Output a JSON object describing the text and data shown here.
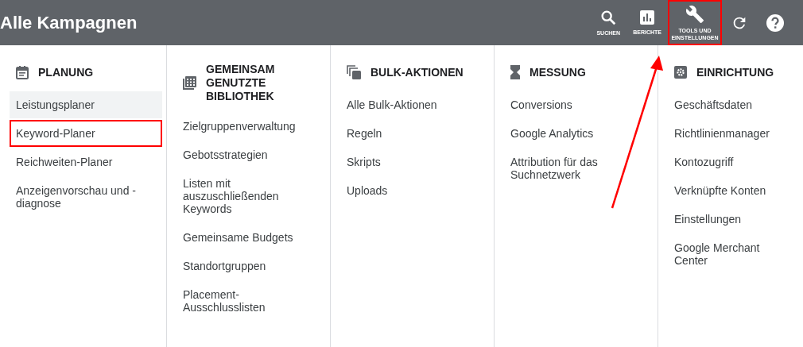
{
  "header": {
    "title": "Alle Kampagnen",
    "actions": [
      {
        "kind": "search",
        "label": "SUCHEN",
        "outlined": false
      },
      {
        "kind": "reports",
        "label": "BERICHTE",
        "outlined": false
      },
      {
        "kind": "tools",
        "label": "TOOLS UND EINSTELLUNGEN",
        "outlined": true
      },
      {
        "kind": "refresh",
        "outlined": false
      },
      {
        "kind": "help",
        "outlined": false
      }
    ]
  },
  "columns": [
    {
      "kind": "calendar",
      "title": "PLANUNG",
      "items": [
        {
          "label": "Leistungsplaner",
          "hovered": true,
          "outlined": false
        },
        {
          "label": "Keyword-Planer",
          "hovered": false,
          "outlined": true
        },
        {
          "label": "Reichweiten-Planer",
          "hovered": false,
          "outlined": false
        },
        {
          "label": "Anzeigenvorschau und -diagnose",
          "hovered": false,
          "outlined": false
        }
      ]
    },
    {
      "kind": "library",
      "title": "GEMEINSAM GENUTZTE BIBLIOTHEK",
      "items": [
        {
          "label": "Zielgruppenverwaltung",
          "hovered": false,
          "outlined": false
        },
        {
          "label": "Gebotsstrategien",
          "hovered": false,
          "outlined": false
        },
        {
          "label": "Listen mit auszuschließenden Keywords",
          "hovered": false,
          "outlined": false
        },
        {
          "label": "Gemeinsame Budgets",
          "hovered": false,
          "outlined": false
        },
        {
          "label": "Standortgruppen",
          "hovered": false,
          "outlined": false
        },
        {
          "label": "Placement-Ausschlusslisten",
          "hovered": false,
          "outlined": false
        }
      ]
    },
    {
      "kind": "copies",
      "title": "BULK-AKTIONEN",
      "items": [
        {
          "label": "Alle Bulk-Aktionen",
          "hovered": false,
          "outlined": false
        },
        {
          "label": "Regeln",
          "hovered": false,
          "outlined": false
        },
        {
          "label": "Skripts",
          "hovered": false,
          "outlined": false
        },
        {
          "label": "Uploads",
          "hovered": false,
          "outlined": false
        }
      ]
    },
    {
      "kind": "hourglass",
      "title": "MESSUNG",
      "items": [
        {
          "label": "Conversions",
          "hovered": false,
          "outlined": false
        },
        {
          "label": "Google Analytics",
          "hovered": false,
          "outlined": false
        },
        {
          "label": "Attribution für das Suchnetzwerk",
          "hovered": false,
          "outlined": false
        }
      ]
    },
    {
      "kind": "gear",
      "title": "EINRICHTUNG",
      "items": [
        {
          "label": "Geschäftsdaten",
          "hovered": false,
          "outlined": false
        },
        {
          "label": "Richtlinienmanager",
          "hovered": false,
          "outlined": false
        },
        {
          "label": "Kontozugriff",
          "hovered": false,
          "outlined": false
        },
        {
          "label": "Verknüpfte Konten",
          "hovered": false,
          "outlined": false
        },
        {
          "label": "Einstellungen",
          "hovered": false,
          "outlined": false
        },
        {
          "label": "Google Merchant Center",
          "hovered": false,
          "outlined": false
        }
      ]
    }
  ]
}
